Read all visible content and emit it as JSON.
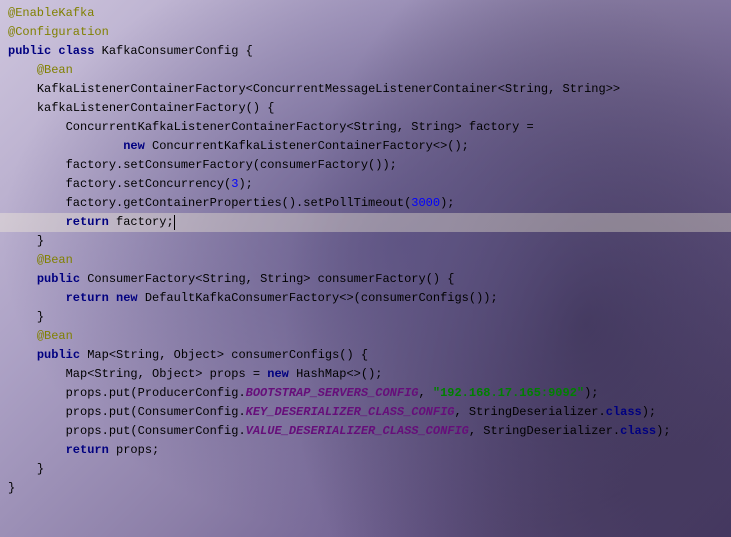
{
  "code": {
    "lines": [
      {
        "indent": 0,
        "hl": false,
        "tokens": [
          {
            "t": "@EnableKafka",
            "c": "ann"
          }
        ]
      },
      {
        "indent": 0,
        "hl": false,
        "tokens": [
          {
            "t": "@Configuration",
            "c": "ann"
          }
        ]
      },
      {
        "indent": 0,
        "hl": false,
        "tokens": [
          {
            "t": "public class ",
            "c": "kw"
          },
          {
            "t": "KafkaConsumerConfig {",
            "c": "plain"
          }
        ]
      },
      {
        "indent": 1,
        "hl": false,
        "tokens": [
          {
            "t": "@Bean",
            "c": "ann"
          }
        ]
      },
      {
        "indent": 1,
        "hl": false,
        "tokens": [
          {
            "t": "KafkaListenerContainerFactory<ConcurrentMessageListenerContainer<String, String>>",
            "c": "plain"
          }
        ]
      },
      {
        "indent": 1,
        "hl": false,
        "tokens": [
          {
            "t": "kafkaListenerContainerFactory() {",
            "c": "plain"
          }
        ]
      },
      {
        "indent": 2,
        "hl": false,
        "tokens": [
          {
            "t": "ConcurrentKafkaListenerContainerFactory<String, String> factory =",
            "c": "plain"
          }
        ]
      },
      {
        "indent": 4,
        "hl": false,
        "tokens": [
          {
            "t": "new ",
            "c": "kw"
          },
          {
            "t": "ConcurrentKafkaListenerContainerFactory<>();",
            "c": "plain"
          }
        ]
      },
      {
        "indent": 2,
        "hl": false,
        "tokens": [
          {
            "t": "factory.setConsumerFactory(consumerFactory());",
            "c": "plain"
          }
        ]
      },
      {
        "indent": 2,
        "hl": false,
        "tokens": [
          {
            "t": "factory.setConcurrency(",
            "c": "plain"
          },
          {
            "t": "3",
            "c": "num"
          },
          {
            "t": ");",
            "c": "plain"
          }
        ]
      },
      {
        "indent": 2,
        "hl": false,
        "tokens": [
          {
            "t": "factory.getContainerProperties().setPollTimeout(",
            "c": "plain"
          },
          {
            "t": "3000",
            "c": "num"
          },
          {
            "t": ");",
            "c": "plain"
          }
        ]
      },
      {
        "indent": 2,
        "hl": true,
        "caret": true,
        "tokens": [
          {
            "t": "return ",
            "c": "kw"
          },
          {
            "t": "factory;",
            "c": "plain"
          }
        ]
      },
      {
        "indent": 1,
        "hl": false,
        "tokens": [
          {
            "t": "}",
            "c": "plain"
          }
        ]
      },
      {
        "indent": 0,
        "hl": false,
        "tokens": [
          {
            "t": "",
            "c": "plain"
          }
        ]
      },
      {
        "indent": 1,
        "hl": false,
        "tokens": [
          {
            "t": "@Bean",
            "c": "ann"
          }
        ]
      },
      {
        "indent": 1,
        "hl": false,
        "tokens": [
          {
            "t": "public ",
            "c": "kw"
          },
          {
            "t": "ConsumerFactory<String, String> consumerFactory() {",
            "c": "plain"
          }
        ]
      },
      {
        "indent": 2,
        "hl": false,
        "tokens": [
          {
            "t": "return new ",
            "c": "kw"
          },
          {
            "t": "DefaultKafkaConsumerFactory<>(consumerConfigs());",
            "c": "plain"
          }
        ]
      },
      {
        "indent": 1,
        "hl": false,
        "tokens": [
          {
            "t": "}",
            "c": "plain"
          }
        ]
      },
      {
        "indent": 0,
        "hl": false,
        "tokens": [
          {
            "t": "",
            "c": "plain"
          }
        ]
      },
      {
        "indent": 1,
        "hl": false,
        "tokens": [
          {
            "t": "@Bean",
            "c": "ann"
          }
        ]
      },
      {
        "indent": 1,
        "hl": false,
        "tokens": [
          {
            "t": "public ",
            "c": "kw"
          },
          {
            "t": "Map<String, Object> consumerConfigs() {",
            "c": "plain"
          }
        ]
      },
      {
        "indent": 2,
        "hl": false,
        "tokens": [
          {
            "t": "Map<String, Object> props = ",
            "c": "plain"
          },
          {
            "t": "new ",
            "c": "kw"
          },
          {
            "t": "HashMap<>();",
            "c": "plain"
          }
        ]
      },
      {
        "indent": 2,
        "hl": false,
        "tokens": [
          {
            "t": "props.put(ProducerConfig.",
            "c": "plain"
          },
          {
            "t": "BOOTSTRAP_SERVERS_CONFIG",
            "c": "const"
          },
          {
            "t": ", ",
            "c": "plain"
          },
          {
            "t": "\"192.168.17.165:9092\"",
            "c": "str"
          },
          {
            "t": ");",
            "c": "plain"
          }
        ]
      },
      {
        "indent": 2,
        "hl": false,
        "tokens": [
          {
            "t": "props.put(ConsumerConfig.",
            "c": "plain"
          },
          {
            "t": "KEY_DESERIALIZER_CLASS_CONFIG",
            "c": "const"
          },
          {
            "t": ", StringDeserializer.",
            "c": "plain"
          },
          {
            "t": "class",
            "c": "kw"
          },
          {
            "t": ");",
            "c": "plain"
          }
        ]
      },
      {
        "indent": 2,
        "hl": false,
        "tokens": [
          {
            "t": "props.put(ConsumerConfig.",
            "c": "plain"
          },
          {
            "t": "VALUE_DESERIALIZER_CLASS_CONFIG",
            "c": "const"
          },
          {
            "t": ", StringDeserializer.",
            "c": "plain"
          },
          {
            "t": "class",
            "c": "kw"
          },
          {
            "t": ");",
            "c": "plain"
          }
        ]
      },
      {
        "indent": 2,
        "hl": false,
        "tokens": [
          {
            "t": "return ",
            "c": "kw"
          },
          {
            "t": "props;",
            "c": "plain"
          }
        ]
      },
      {
        "indent": 1,
        "hl": false,
        "tokens": [
          {
            "t": "}",
            "c": "plain"
          }
        ]
      },
      {
        "indent": 0,
        "hl": false,
        "tokens": [
          {
            "t": "}",
            "c": "plain"
          }
        ]
      }
    ]
  },
  "indent_unit": "    "
}
